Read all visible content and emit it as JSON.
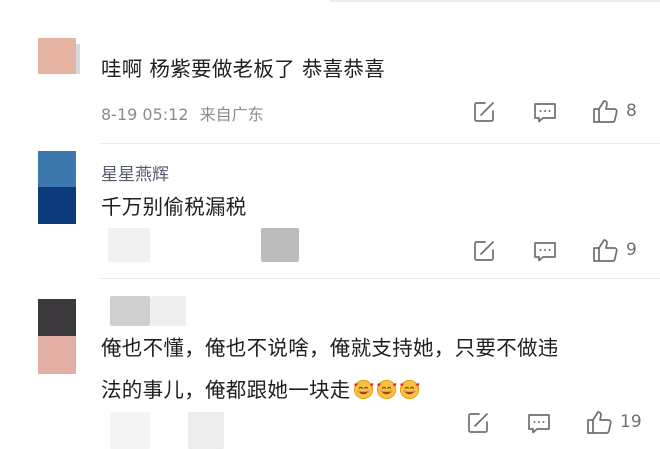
{
  "comments": [
    {
      "username": "",
      "text_lines": [
        "哇啊 杨紫要做老板了 恭喜恭喜"
      ],
      "timestamp": "8-19 05:12",
      "location": "来自广东",
      "like_count": "8",
      "avatar_colors": [
        "#e6b3a3",
        "#ffffff"
      ]
    },
    {
      "username": "星星燕辉",
      "text_lines": [
        "千万别偷税漏税"
      ],
      "timestamp": "",
      "location": "",
      "like_count": "9",
      "avatar_colors": [
        "#3d78ac",
        "#0c3a7b"
      ]
    },
    {
      "username": "",
      "text_lines": [
        "俺也不懂，俺也不说啥，俺就支持她，只要不做违",
        "法的事儿，俺都跟她一块走"
      ],
      "emoji": [
        "smiling-face-with-hearts",
        "smiling-face-with-hearts",
        "smiling-face-with-hearts"
      ],
      "timestamp": "",
      "location": "",
      "like_count": "19",
      "avatar_colors": [
        "#3b393c",
        "#e2aea5"
      ]
    }
  ],
  "colors": {
    "text": "#1f1f1f",
    "username": "#555c6b",
    "meta": "#8c8c8c",
    "icon": "#6f6f6f",
    "divider": "#ececec"
  },
  "icons": [
    "share-icon",
    "comment-icon",
    "like-icon"
  ]
}
